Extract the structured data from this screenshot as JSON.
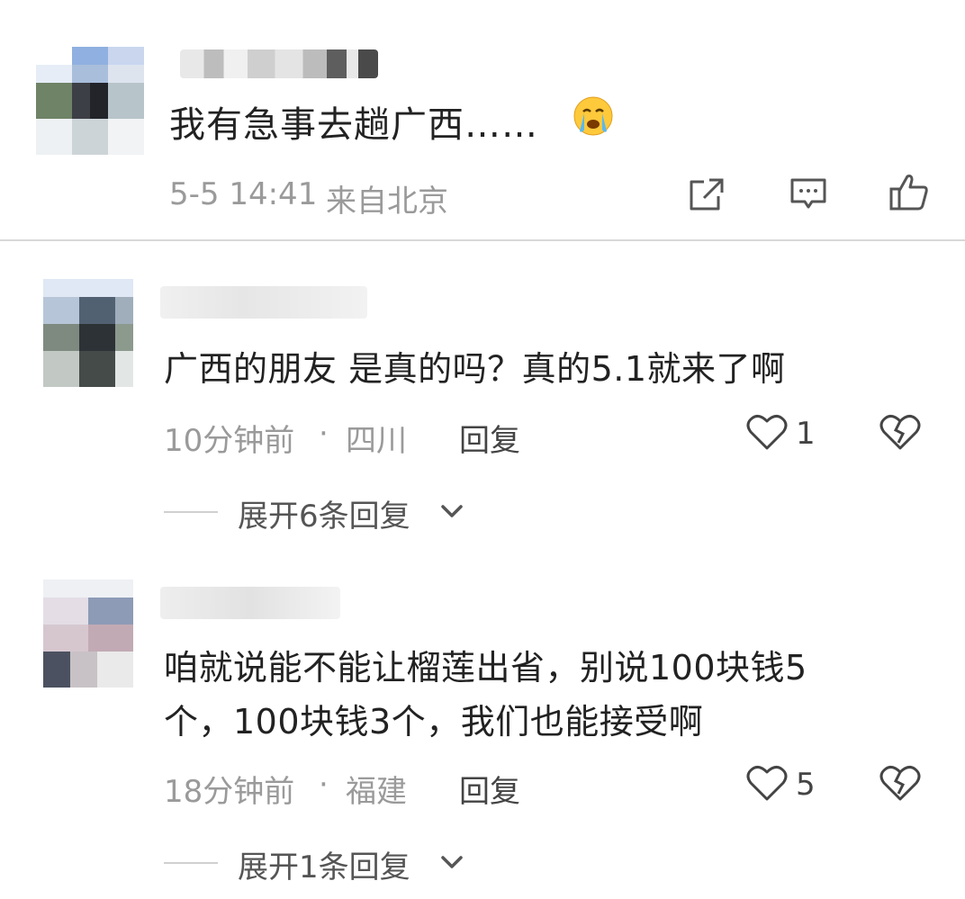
{
  "post": {
    "text": "我有急事去趟广西……",
    "time": "5-5 14:41",
    "location": "来自北京",
    "actions": [
      "share-icon",
      "comment-icon",
      "like-icon"
    ]
  },
  "comments": [
    {
      "text": "广西的朋友 是真的吗？真的5.1就来了啊",
      "time": "10分钟前",
      "region": "四川",
      "reply_label": "回复",
      "likes": "1",
      "expand_label": "展开6条回复"
    },
    {
      "text_line1": "咱就说能不能让榴莲出省，别说100块钱5",
      "text_line2": "个，100块钱3个，我们也能接受啊",
      "time": "18分钟前",
      "region": "福建",
      "reply_label": "回复",
      "likes": "5",
      "expand_label": "展开1条回复"
    }
  ],
  "separator": "·",
  "colors": {
    "meta": "#9a9a9a",
    "text": "#222222",
    "icon": "#555555"
  }
}
